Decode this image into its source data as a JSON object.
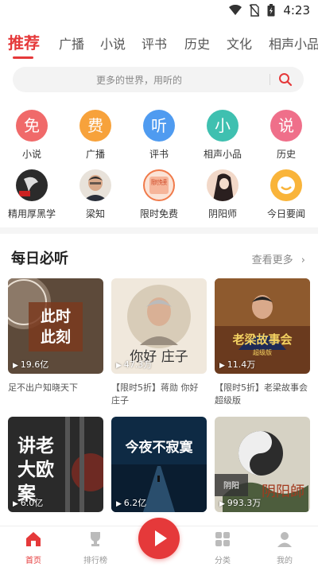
{
  "status": {
    "time": "4:23"
  },
  "tabs": [
    "推荐",
    "广播",
    "小说",
    "评书",
    "历史",
    "文化",
    "相声小品"
  ],
  "search": {
    "placeholder": "更多的世界，用听的"
  },
  "categories": [
    {
      "label": "小说",
      "glyph": "免",
      "color": "#f06a6a"
    },
    {
      "label": "广播",
      "glyph": "费",
      "color": "#f7a23b"
    },
    {
      "label": "评书",
      "glyph": "听",
      "color": "#4f9bf0"
    },
    {
      "label": "相声小品",
      "glyph": "小",
      "color": "#3fc0b0"
    },
    {
      "label": "历史",
      "glyph": "说",
      "color": "#ef6f8a"
    }
  ],
  "subcategories": [
    {
      "label": "精用厚黑学"
    },
    {
      "label": "梁知"
    },
    {
      "label": "限时免费",
      "badge": "限时免费"
    },
    {
      "label": "阴阳师"
    },
    {
      "label": "今日要闻"
    }
  ],
  "daily": {
    "title": "每日必听",
    "more": "查看更多",
    "cards": [
      {
        "cover": "此时此刻",
        "count": "19.6亿",
        "title": "足不出户知晓天下"
      },
      {
        "cover": "你好庄子",
        "count": "47.3万",
        "title": "【限时5折】蒋勋 你好庄子"
      },
      {
        "cover": "老梁故事会",
        "count": "11.4万",
        "title": "【限时5折】老梁故事会超级版"
      },
      {
        "cover": "讲老大欧案",
        "count": "6.0亿",
        "title": ""
      },
      {
        "cover": "今夜不寂寞",
        "count": "6.2亿",
        "title": ""
      },
      {
        "cover": "阴阳师",
        "count": "993.3万",
        "title": ""
      }
    ]
  },
  "nav": [
    {
      "label": "首页"
    },
    {
      "label": "排行榜"
    },
    {
      "label": "分类"
    },
    {
      "label": "我的"
    }
  ]
}
